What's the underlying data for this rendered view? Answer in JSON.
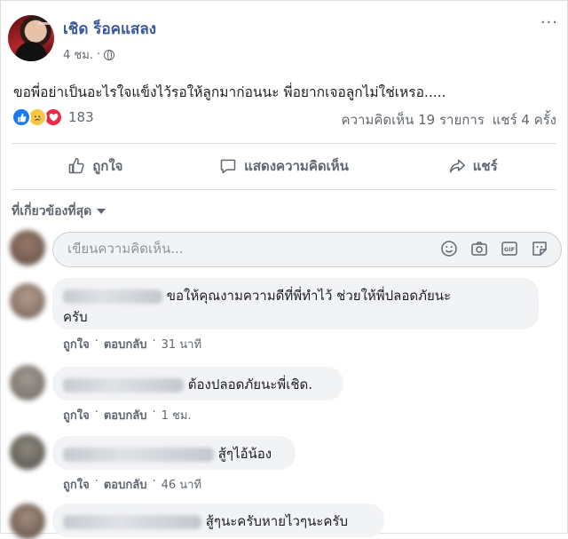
{
  "post": {
    "author": "เชิด ร็อคแสลง",
    "time": "4 ชม.",
    "more": "···",
    "text": "ขอพี่อย่าเป็นอะไรใจแข็งไว้รอให้ลูกมาก่อนนะ พี่อยากเจอลูกไม่ใช่เหรอ.....",
    "reaction_count": "183",
    "comment_count": "ความคิดเห็น 19 รายการ",
    "share_count": "แชร์ 4 ครั้ง"
  },
  "actions": {
    "like": "ถูกใจ",
    "comment": "แสดงความคิดเห็น",
    "share": "แชร์"
  },
  "filter_label": "ที่เกี่ยวข้องที่สุด",
  "composer": {
    "placeholder": "เขียนความคิดเห็น...",
    "icons": [
      "emoji-icon",
      "camera-icon",
      "gif-icon",
      "sticker-icon"
    ]
  },
  "comments": [
    {
      "text_line1": "ขอให้คุณงามความดีที่พี่ทำไว้ ช่วยให้พี่ปลอดภัยนะ",
      "text_line2": "ครับ",
      "like": "ถูกใจ",
      "reply": "ตอบกลับ",
      "time": "31 นาที"
    },
    {
      "text_line1": "ต้องปลอดภัยนะพี่เชิด.",
      "like": "ถูกใจ",
      "reply": "ตอบกลับ",
      "time": "1 ชม."
    },
    {
      "text_line1": "สู้ๆไอ้น้อง",
      "like": "ถูกใจ",
      "reply": "ตอบกลับ",
      "time": "46 นาที"
    },
    {
      "text_line1": "สู้ๆนะครับหายไวๆนะครับ"
    }
  ],
  "colors": {
    "author_link": "#385898",
    "like_blue": "#1877f2",
    "bubble": "#f2f3f5",
    "muted": "#606770"
  }
}
